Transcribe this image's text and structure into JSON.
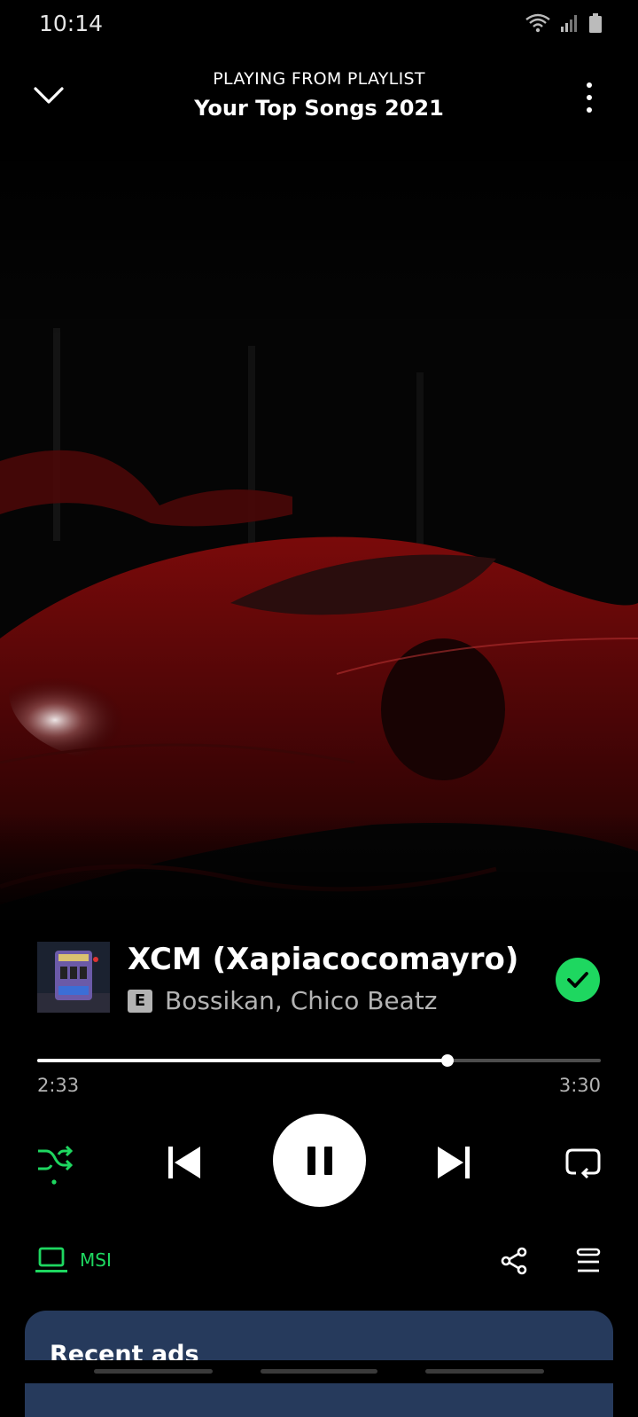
{
  "status_bar": {
    "time": "10:14"
  },
  "header": {
    "context_label": "PLAYING FROM PLAYLIST",
    "playlist_name": "Your Top Songs 2021"
  },
  "track": {
    "title": "XCM (Xapiacocomayro)",
    "explicit_badge": "E",
    "artists": "Bossikan, Chico Beatz",
    "liked": true
  },
  "playback": {
    "elapsed": "2:33",
    "duration": "3:30",
    "progress_fraction": 0.7286,
    "state": "playing",
    "shuffle": true
  },
  "device": {
    "name": "MSI"
  },
  "card": {
    "title": "Recent ads"
  },
  "colors": {
    "accent": "#1ed760",
    "background": "#000000",
    "secondary_text": "#b3b3b3",
    "card": "#263a5c"
  },
  "icons": {
    "collapse": "chevron-down-icon",
    "more": "more-vertical-icon",
    "shuffle": "shuffle-icon",
    "previous": "skip-previous-icon",
    "pause": "pause-icon",
    "next": "skip-next-icon",
    "repeat": "repeat-icon",
    "device": "laptop-icon",
    "share": "share-icon",
    "queue": "queue-icon",
    "liked": "check-circle-icon"
  }
}
